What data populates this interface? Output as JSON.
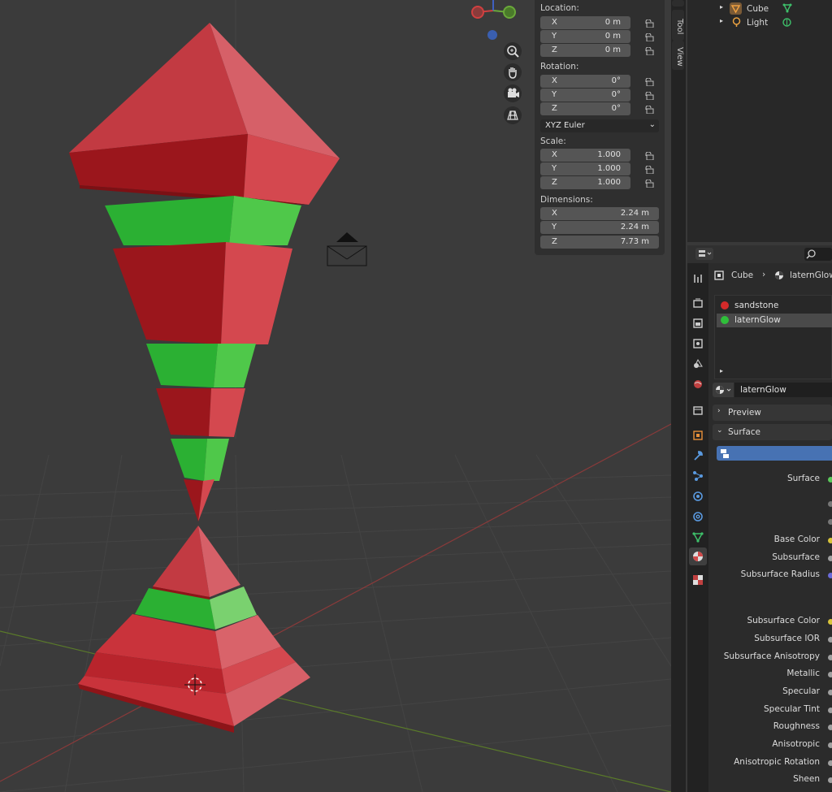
{
  "viewport": {
    "npanel": {
      "location": {
        "title": "Location:",
        "x_label": "X",
        "x": "0 m",
        "y_label": "Y",
        "y": "0 m",
        "z_label": "Z",
        "z": "0 m"
      },
      "rotation": {
        "title": "Rotation:",
        "x_label": "X",
        "x": "0°",
        "y_label": "Y",
        "y": "0°",
        "z_label": "Z",
        "z": "0°",
        "mode": "XYZ Euler"
      },
      "scale": {
        "title": "Scale:",
        "x_label": "X",
        "x": "1.000",
        "y_label": "Y",
        "y": "1.000",
        "z_label": "Z",
        "z": "1.000"
      },
      "dimensions": {
        "title": "Dimensions:",
        "x_label": "X",
        "x": "2.24 m",
        "y_label": "Y",
        "y": "2.24 m",
        "z_label": "Z",
        "z": "7.73 m"
      }
    },
    "side_tabs": {
      "tool": "Tool",
      "view": "View"
    },
    "navigation": [
      "zoom-icon",
      "pan-hand-icon",
      "camera-view-icon",
      "grid-ortho-icon"
    ]
  },
  "outliner": {
    "items": [
      {
        "name": "Cube",
        "icon": "mesh-object-icon"
      },
      {
        "name": "Light",
        "icon": "light-object-icon"
      }
    ]
  },
  "properties": {
    "breadcrumb": {
      "object": "Cube",
      "material": "laternGlow"
    },
    "material_slots": [
      {
        "name": "sandstone",
        "color": "#d32a2a"
      },
      {
        "name": "laternGlow",
        "color": "#2fbf3a"
      }
    ],
    "material_name": "laternGlow",
    "panels": {
      "preview": "Preview",
      "surface": "Surface"
    },
    "surface_inputs": [
      "Surface",
      "Base Color",
      "Subsurface",
      "Subsurface Radius",
      "Subsurface Color",
      "Subsurface IOR",
      "Subsurface Anisotropy",
      "Metallic",
      "Specular",
      "Specular Tint",
      "Roughness",
      "Anisotropic",
      "Anisotropic Rotation",
      "Sheen"
    ],
    "colors": {
      "selected": "#4772b3",
      "red": "#c8323a",
      "green": "#2fb83a"
    }
  }
}
